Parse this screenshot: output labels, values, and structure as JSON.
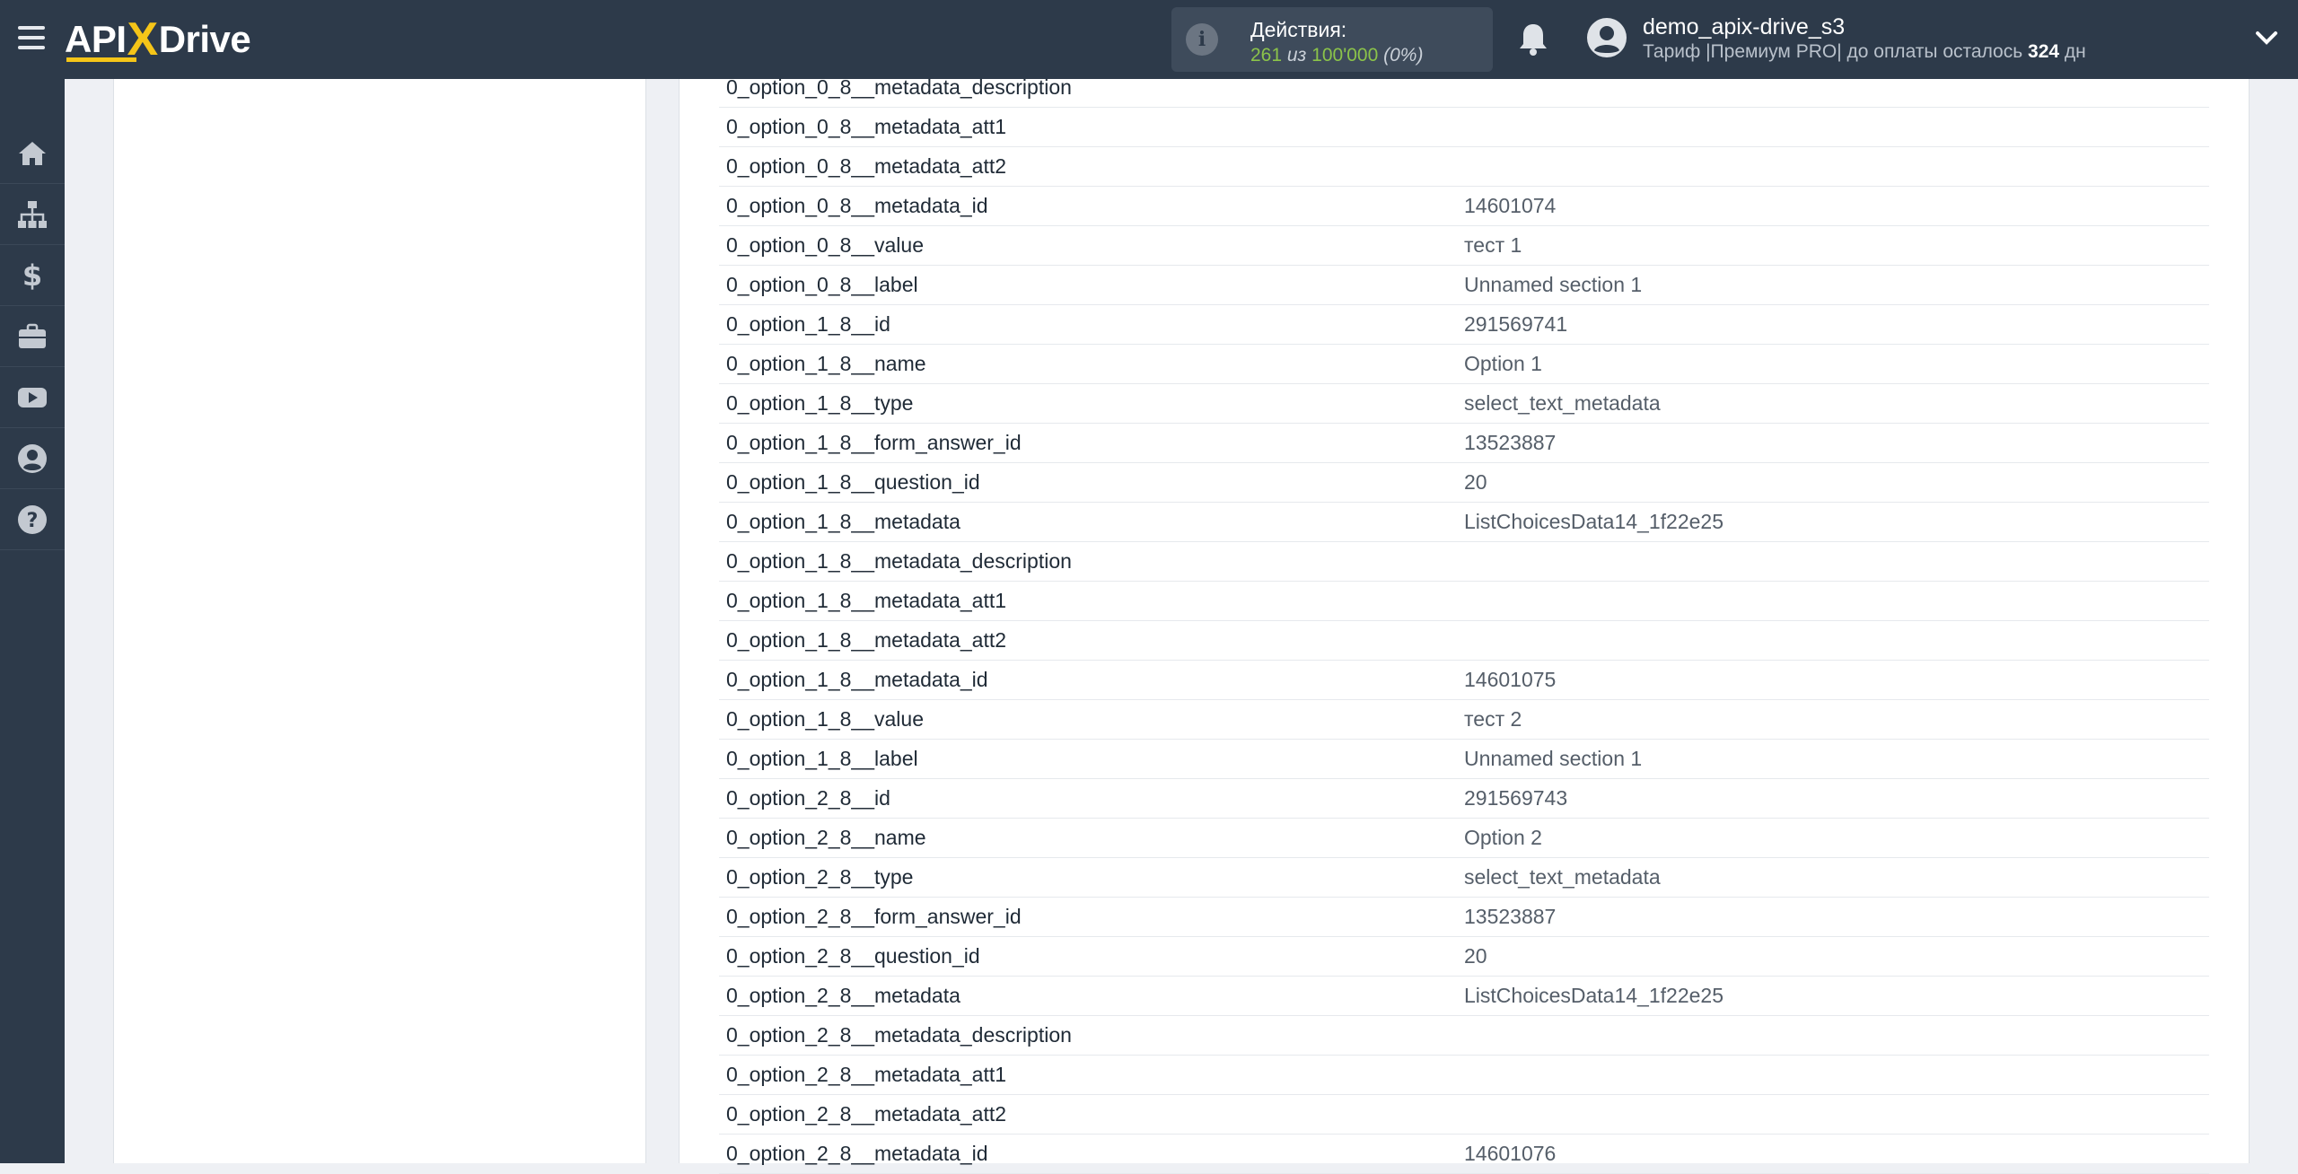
{
  "header": {
    "logo_api": "API",
    "logo_x": "X",
    "logo_drive": "Drive",
    "actions_label": "Действия:",
    "actions_used": "261",
    "actions_of": " из ",
    "actions_total": "100'000",
    "actions_pct": " (0%)",
    "username": "demo_apix-drive_s3",
    "tariff_prefix": "Тариф |Премиум PRO| до оплаты осталось ",
    "tariff_days": "324",
    "tariff_suffix": " дн"
  },
  "sidebar": {
    "items": [
      {
        "name": "home-icon"
      },
      {
        "name": "sitemap-icon"
      },
      {
        "name": "dollar-icon"
      },
      {
        "name": "briefcase-icon"
      },
      {
        "name": "youtube-icon"
      },
      {
        "name": "user-icon"
      },
      {
        "name": "help-icon"
      }
    ]
  },
  "rows": [
    {
      "key": "0_option_0_8__metadata_description",
      "value": ""
    },
    {
      "key": "0_option_0_8__metadata_att1",
      "value": ""
    },
    {
      "key": "0_option_0_8__metadata_att2",
      "value": ""
    },
    {
      "key": "0_option_0_8__metadata_id",
      "value": "14601074"
    },
    {
      "key": "0_option_0_8__value",
      "value": "тест 1"
    },
    {
      "key": "0_option_0_8__label",
      "value": "Unnamed section 1"
    },
    {
      "key": "0_option_1_8__id",
      "value": "291569741"
    },
    {
      "key": "0_option_1_8__name",
      "value": "Option 1"
    },
    {
      "key": "0_option_1_8__type",
      "value": "select_text_metadata"
    },
    {
      "key": "0_option_1_8__form_answer_id",
      "value": "13523887"
    },
    {
      "key": "0_option_1_8__question_id",
      "value": "20"
    },
    {
      "key": "0_option_1_8__metadata",
      "value": "ListChoicesData14_1f22e25"
    },
    {
      "key": "0_option_1_8__metadata_description",
      "value": ""
    },
    {
      "key": "0_option_1_8__metadata_att1",
      "value": ""
    },
    {
      "key": "0_option_1_8__metadata_att2",
      "value": ""
    },
    {
      "key": "0_option_1_8__metadata_id",
      "value": "14601075"
    },
    {
      "key": "0_option_1_8__value",
      "value": "тест 2"
    },
    {
      "key": "0_option_1_8__label",
      "value": "Unnamed section 1"
    },
    {
      "key": "0_option_2_8__id",
      "value": "291569743"
    },
    {
      "key": "0_option_2_8__name",
      "value": "Option 2"
    },
    {
      "key": "0_option_2_8__type",
      "value": "select_text_metadata"
    },
    {
      "key": "0_option_2_8__form_answer_id",
      "value": "13523887"
    },
    {
      "key": "0_option_2_8__question_id",
      "value": "20"
    },
    {
      "key": "0_option_2_8__metadata",
      "value": "ListChoicesData14_1f22e25"
    },
    {
      "key": "0_option_2_8__metadata_description",
      "value": ""
    },
    {
      "key": "0_option_2_8__metadata_att1",
      "value": ""
    },
    {
      "key": "0_option_2_8__metadata_att2",
      "value": ""
    },
    {
      "key": "0_option_2_8__metadata_id",
      "value": "14601076"
    }
  ]
}
